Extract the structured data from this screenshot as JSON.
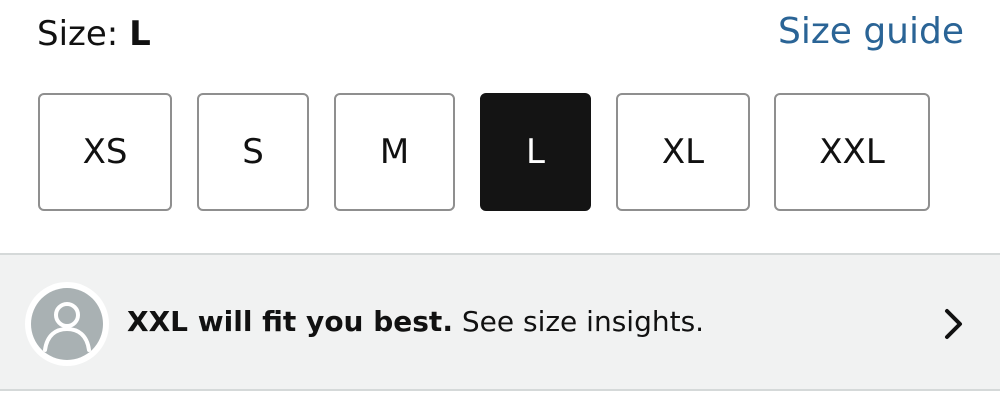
{
  "size_selector": {
    "label_prefix": "Size: ",
    "selected_value": "L",
    "size_guide_link": "Size guide",
    "options": [
      {
        "label": "XS",
        "selected": false
      },
      {
        "label": "S",
        "selected": false
      },
      {
        "label": "M",
        "selected": false
      },
      {
        "label": "L",
        "selected": true
      },
      {
        "label": "XL",
        "selected": false
      },
      {
        "label": "XXL",
        "selected": false
      }
    ]
  },
  "size_insights": {
    "recommendation": "XXL will fit you best.",
    "link_text": " See size insights.",
    "avatar_icon": "user-avatar-icon",
    "chevron_icon": "chevron-right-icon"
  },
  "colors": {
    "link": "#2a6496",
    "selected_bg": "#141414",
    "banner_bg": "#f1f2f2",
    "avatar_bg": "#a9b1b3"
  }
}
